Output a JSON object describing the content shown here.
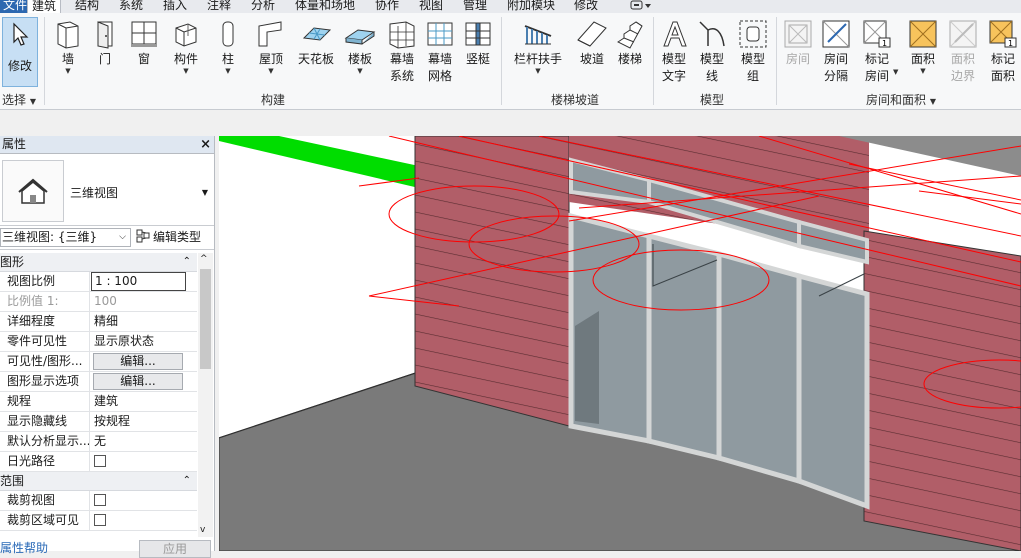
{
  "menu": {
    "tabs": [
      {
        "label": "文件"
      },
      {
        "label": "建筑"
      },
      {
        "label": "结构"
      },
      {
        "label": "系统"
      },
      {
        "label": "插入"
      },
      {
        "label": "注释"
      },
      {
        "label": "分析"
      },
      {
        "label": "体量和场地"
      },
      {
        "label": "协作"
      },
      {
        "label": "视图"
      },
      {
        "label": "管理"
      },
      {
        "label": "附加模块"
      },
      {
        "label": "修改"
      }
    ],
    "active_tab": "建筑"
  },
  "ribbon": {
    "modify": {
      "label": "修改",
      "icon": "cursor-arrow-icon"
    },
    "select_group": "选择",
    "build_group": "构建",
    "stair_group": "楼梯坡道",
    "model_group": "模型",
    "room_group": "房间和面积",
    "build_tools": [
      {
        "label": "墙",
        "icon": "wall-icon"
      },
      {
        "label": "门",
        "icon": "door-icon"
      },
      {
        "label": "窗",
        "icon": "window-icon"
      },
      {
        "label": "构件",
        "icon": "component-icon"
      },
      {
        "label": "柱",
        "icon": "column-icon"
      },
      {
        "label": "屋顶",
        "icon": "roof-icon"
      },
      {
        "label": "天花板",
        "icon": "ceiling-icon"
      },
      {
        "label": "楼板",
        "icon": "floor-icon"
      },
      {
        "label": "幕墙",
        "label2": "系统",
        "icon": "curtain-system-icon"
      },
      {
        "label": "幕墙",
        "label2": "网格",
        "icon": "curtain-grid-icon"
      },
      {
        "label": "竖梃",
        "icon": "mullion-icon"
      }
    ],
    "stair_tools": [
      {
        "label": "栏杆扶手",
        "icon": "railing-icon"
      },
      {
        "label": "坡道",
        "icon": "ramp-icon"
      },
      {
        "label": "楼梯",
        "icon": "stair-icon"
      }
    ],
    "model_tools": [
      {
        "label": "模型",
        "label2": "文字",
        "icon": "model-text-icon"
      },
      {
        "label": "模型",
        "label2": "线",
        "icon": "model-line-icon"
      },
      {
        "label": "模型",
        "label2": "组",
        "icon": "model-group-icon"
      }
    ],
    "room_tools": [
      {
        "label": "房间",
        "icon": "room-icon"
      },
      {
        "label": "房间",
        "label2": "分隔",
        "icon": "room-separator-icon"
      },
      {
        "label": "标记",
        "label2": "房间",
        "icon": "tag-room-icon"
      },
      {
        "label": "面积",
        "icon": "area-icon"
      },
      {
        "label": "面积",
        "label2": "边界",
        "icon": "area-boundary-icon"
      },
      {
        "label": "标记",
        "label2": "面积",
        "icon": "tag-area-icon"
      }
    ]
  },
  "properties": {
    "title": "属性",
    "type_name": "三维视图",
    "view_selector": "三维视图: {三维}",
    "edit_type": "编辑类型",
    "sections": {
      "graphics": "图形",
      "extents": "范围"
    },
    "rows": [
      {
        "key": "视图比例",
        "value": "1 : 100"
      },
      {
        "key": "比例值 1:",
        "value": "100"
      },
      {
        "key": "详细程度",
        "value": "精细"
      },
      {
        "key": "零件可见性",
        "value": "显示原状态"
      },
      {
        "key": "可见性/图形...",
        "value": "编辑..."
      },
      {
        "key": "图形显示选项",
        "value": "编辑..."
      },
      {
        "key": "规程",
        "value": "建筑"
      },
      {
        "key": "显示隐藏线",
        "value": "按规程"
      },
      {
        "key": "默认分析显示...",
        "value": "无"
      },
      {
        "key": "日光路径",
        "value": ""
      },
      {
        "key": "裁剪视图",
        "value": ""
      },
      {
        "key": "裁剪区域可见",
        "value": ""
      }
    ],
    "help": "属性帮助",
    "apply": "应用"
  },
  "colors": {
    "wall": "#b15e68",
    "glass": "#8f9aa0",
    "frame": "#d4d6d6",
    "selection": "#ff0000",
    "green": "#00dd00",
    "floor": "#7a7a7a",
    "roof": "#8c8c8c"
  }
}
